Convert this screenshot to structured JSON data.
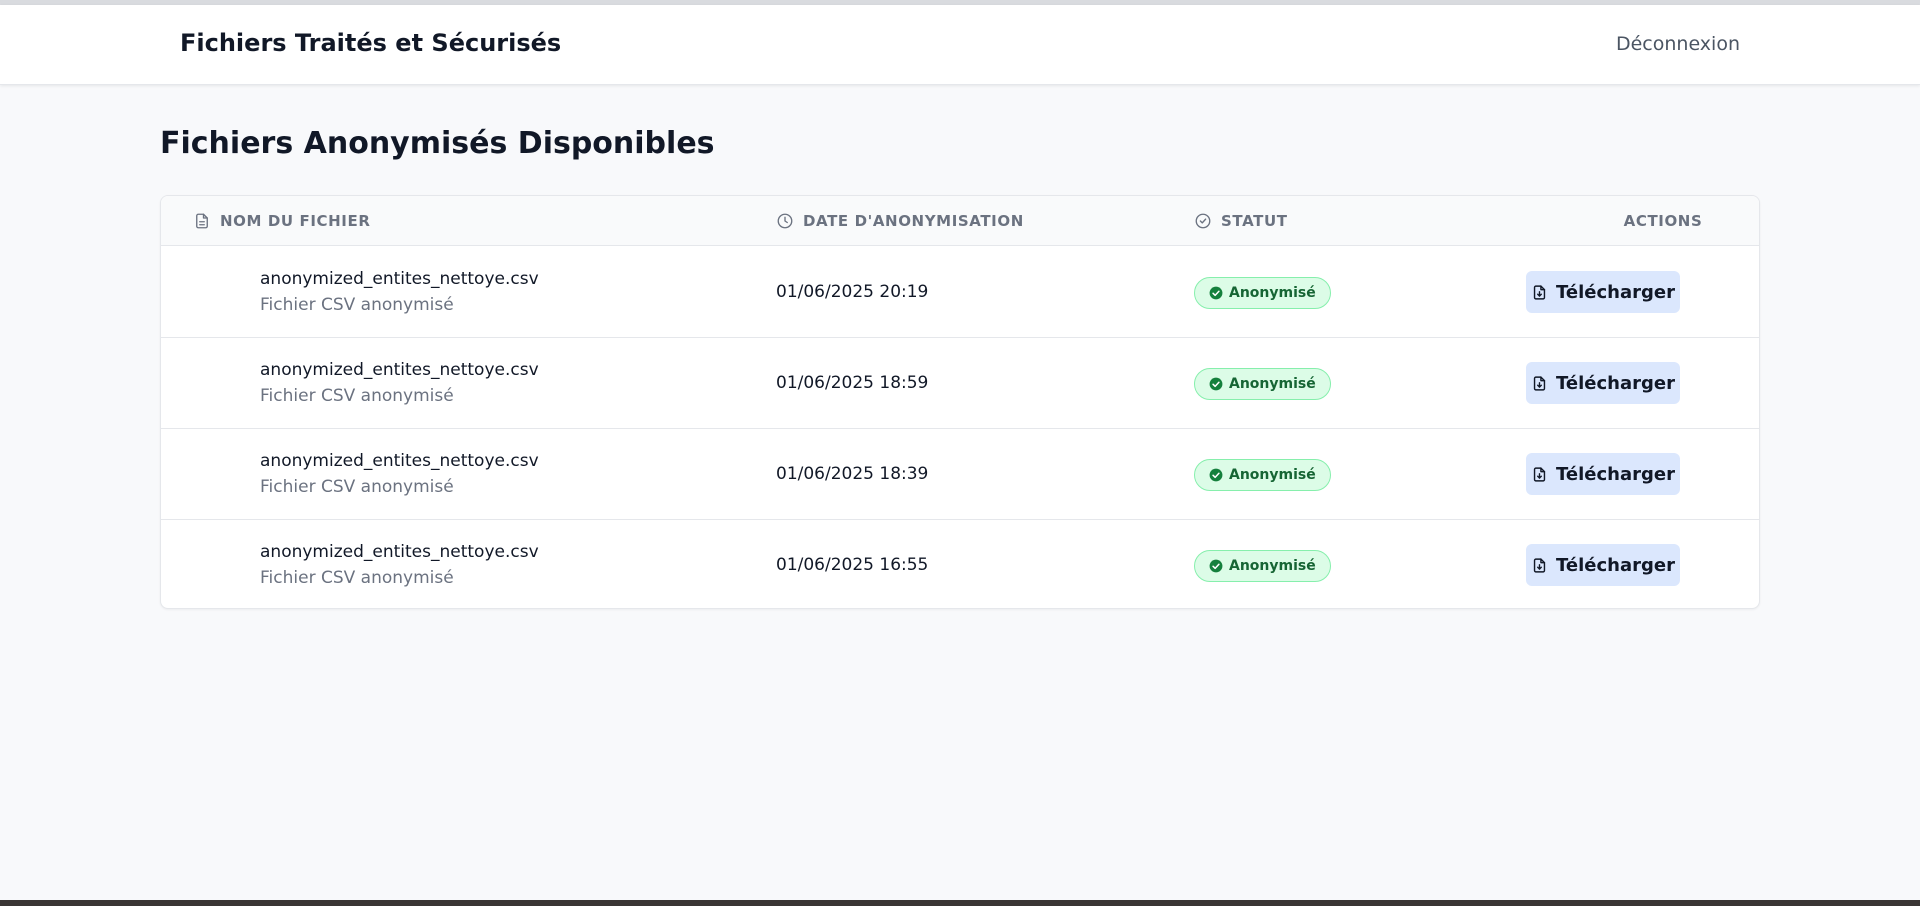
{
  "navbar": {
    "title": "Fichiers Traités et Sécurisés",
    "logout_label": "Déconnexion"
  },
  "page": {
    "title": "Fichiers Anonymisés Disponibles"
  },
  "table": {
    "headers": {
      "name": "NOM DU FICHIER",
      "date": "DATE D'ANONYMISATION",
      "status": "STATUT",
      "actions": "ACTIONS"
    },
    "rows": [
      {
        "file_name": "anonymized_entites_nettoye.csv",
        "file_type": "Fichier CSV anonymisé",
        "date": "01/06/2025 20:19",
        "status": "Anonymisé",
        "action": "Télécharger"
      },
      {
        "file_name": "anonymized_entites_nettoye.csv",
        "file_type": "Fichier CSV anonymisé",
        "date": "01/06/2025 18:59",
        "status": "Anonymisé",
        "action": "Télécharger"
      },
      {
        "file_name": "anonymized_entites_nettoye.csv",
        "file_type": "Fichier CSV anonymisé",
        "date": "01/06/2025 18:39",
        "status": "Anonymisé",
        "action": "Télécharger"
      },
      {
        "file_name": "anonymized_entites_nettoye.csv",
        "file_type": "Fichier CSV anonymisé",
        "date": "01/06/2025 16:55",
        "status": "Anonymisé",
        "action": "Télécharger"
      }
    ]
  },
  "icons": {
    "name_header": "document-icon",
    "date_header": "clock-icon",
    "status_header": "check-circle-icon",
    "status_badge": "check-circle-filled-icon",
    "download": "file-download-icon"
  },
  "colors": {
    "status_bg": "#dcfce7",
    "status_text": "#166534",
    "button_bg": "#dbe7fd"
  }
}
